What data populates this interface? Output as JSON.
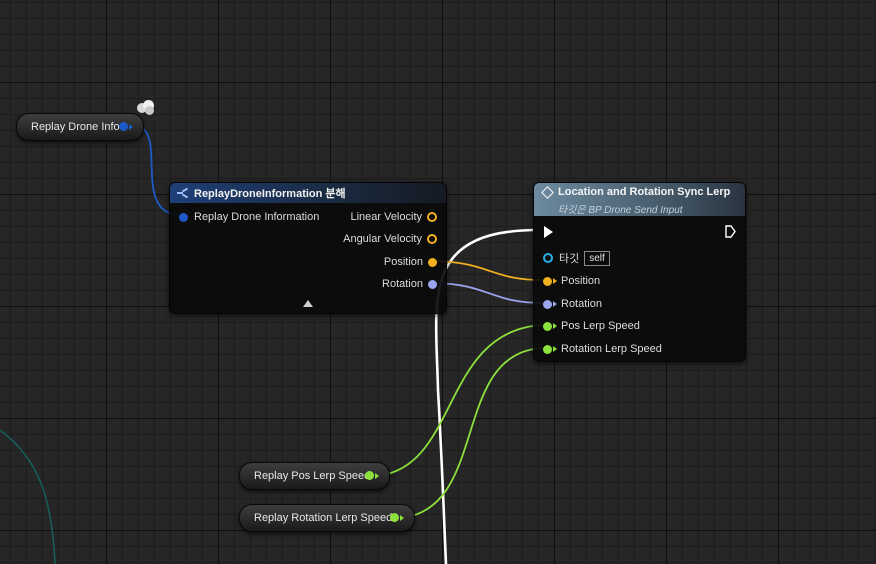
{
  "wire_colors": {
    "struct": "#1d5ac8",
    "vector": "#f0b020",
    "rotator": "#9aa6f0",
    "float": "#8ce13c",
    "exec": "#ffffff",
    "object": "#14605a"
  },
  "replay_var": {
    "label": "Replay Drone Info",
    "pin_color": "#1d5ac8"
  },
  "break_node": {
    "title": "ReplayDroneInformation 분해",
    "header_color": "#1f3f78",
    "input_pin": "Replay Drone Information",
    "outputs": [
      {
        "label": "Linear Velocity",
        "color": "#f0b020",
        "connected": false
      },
      {
        "label": "Angular Velocity",
        "color": "#f0b020",
        "connected": false
      },
      {
        "label": "Position",
        "color": "#f0b020",
        "connected": true
      },
      {
        "label": "Rotation",
        "color": "#9aa6f0",
        "connected": true
      }
    ],
    "collapse_icon": "triangle-up-icon"
  },
  "sync_node": {
    "title": "Location and Rotation Sync Lerp",
    "subtitle": "타깃은 BP Drone Send Input",
    "header_color": "#5e7a8e",
    "target_label": "타깃",
    "target_value": "self",
    "inputs": [
      {
        "label": "Position",
        "color": "#f0b020"
      },
      {
        "label": "Rotation",
        "color": "#9aa6f0"
      },
      {
        "label": "Pos Lerp Speed",
        "color": "#8ce13c"
      },
      {
        "label": "Rotation Lerp Speed",
        "color": "#8ce13c"
      }
    ]
  },
  "pos_lerp_var": {
    "label": "Replay Pos Lerp Speed",
    "pin_color": "#8ce13c"
  },
  "rot_lerp_var": {
    "label": "Replay Rotation Lerp Speed",
    "pin_color": "#8ce13c"
  }
}
